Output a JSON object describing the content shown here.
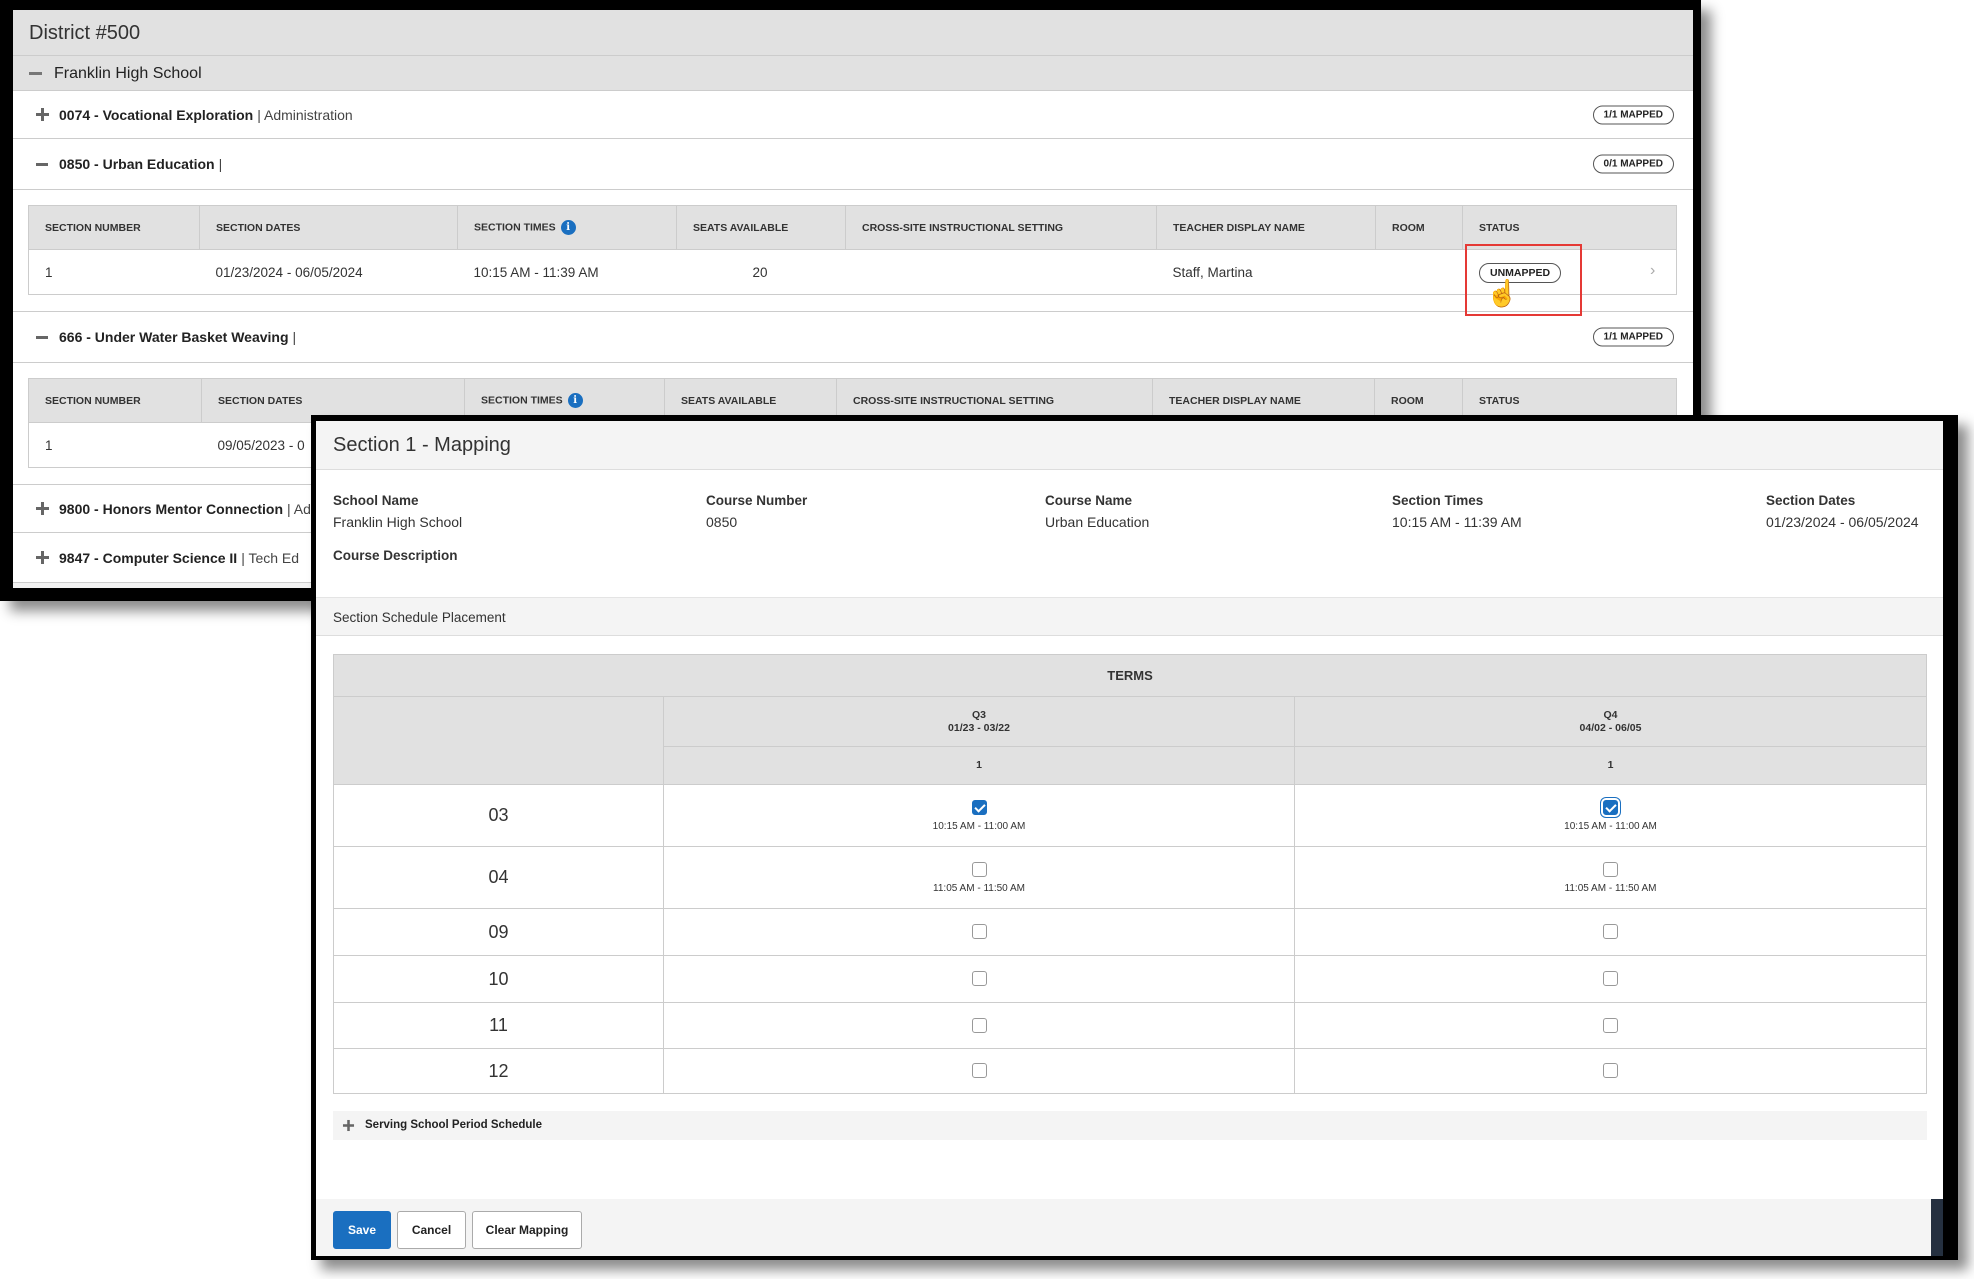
{
  "district": {
    "title": "District #500"
  },
  "school": {
    "name": "Franklin High School"
  },
  "columns": [
    "SECTION NUMBER",
    "SECTION DATES",
    "SECTION TIMES",
    "SEATS AVAILABLE",
    "CROSS-SITE INSTRUCTIONAL SETTING",
    "TEACHER DISPLAY NAME",
    "ROOM",
    "STATUS"
  ],
  "courses": [
    {
      "code_name": "0074 - Vocational Exploration",
      "dept": "| Administration",
      "badge": "1/1 MAPPED",
      "expanded": false
    },
    {
      "code_name": "0850 - Urban Education",
      "dept": "|",
      "badge": "0/1 MAPPED",
      "expanded": true,
      "row": {
        "number": "1",
        "dates": "01/23/2024 - 06/05/2024",
        "times": "10:15 AM - 11:39 AM",
        "seats": "20",
        "cross_site": "",
        "teacher": "Staff, Martina",
        "room": "",
        "status": "UNMAPPED"
      }
    },
    {
      "code_name": "666 - Under Water Basket Weaving",
      "dept": "|",
      "badge": "1/1 MAPPED",
      "expanded": true,
      "row": {
        "number": "1",
        "dates": "09/05/2023 - 0"
      }
    },
    {
      "code_name": "9800 - Honors Mentor Connection",
      "dept": "| Adr",
      "expanded": false
    },
    {
      "code_name": "9847 - Computer Science II",
      "dept": "| Tech Ed",
      "expanded": false
    }
  ],
  "modal": {
    "title": "Section 1 - Mapping",
    "fields": [
      {
        "label": "School Name",
        "value": "Franklin High School"
      },
      {
        "label": "Course Number",
        "value": "0850"
      },
      {
        "label": "Course Name",
        "value": "Urban Education"
      },
      {
        "label": "Section Times",
        "value": "10:15 AM - 11:39 AM"
      },
      {
        "label": "Section Dates",
        "value": "01/23/2024 - 06/05/2024"
      },
      {
        "label": "Course Description",
        "value": ""
      }
    ],
    "placement_title": "Section Schedule Placement",
    "terms_header": "TERMS",
    "terms": [
      {
        "name": "Q3",
        "dates": "01/23 - 03/22",
        "schedule": "1"
      },
      {
        "name": "Q4",
        "dates": "04/02 - 06/05",
        "schedule": "1"
      }
    ],
    "periods": [
      {
        "period": "03",
        "cells": [
          {
            "checked": true,
            "time": "10:15 AM - 11:00 AM"
          },
          {
            "checked": true,
            "time": "10:15 AM - 11:00 AM"
          }
        ]
      },
      {
        "period": "04",
        "cells": [
          {
            "checked": false,
            "time": "11:05 AM - 11:50 AM"
          },
          {
            "checked": false,
            "time": "11:05 AM - 11:50 AM"
          }
        ]
      },
      {
        "period": "09",
        "cells": [
          {
            "checked": false
          },
          {
            "checked": false
          }
        ]
      },
      {
        "period": "10",
        "cells": [
          {
            "checked": false
          },
          {
            "checked": false
          }
        ]
      },
      {
        "period": "11",
        "cells": [
          {
            "checked": false
          },
          {
            "checked": false
          }
        ]
      },
      {
        "period": "12",
        "cells": [
          {
            "checked": false
          },
          {
            "checked": false
          }
        ]
      }
    ],
    "serving_label": "Serving School Period Schedule",
    "buttons": {
      "save": "Save",
      "cancel": "Cancel",
      "clear": "Clear Mapping"
    }
  },
  "colors": {
    "accent": "#1a6fc0",
    "highlight": "#e53935"
  }
}
